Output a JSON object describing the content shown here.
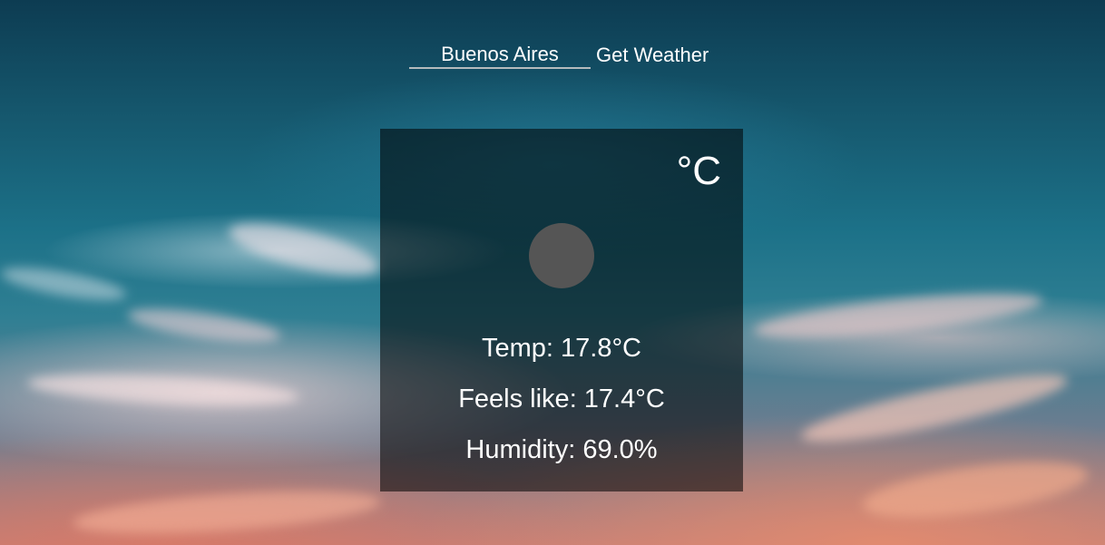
{
  "search": {
    "city_value": "Buenos Aires",
    "button_label": "Get Weather"
  },
  "weather": {
    "unit_label": "°C",
    "temp_label": "Temp: 17.8°C",
    "feels_like_label": "Feels like: 17.4°C",
    "humidity_label": "Humidity: 69.0%",
    "icon": "weather-condition-icon"
  },
  "colors": {
    "card_bg": "#000000",
    "icon_placeholder": "#555555",
    "text": "#ffffff"
  }
}
